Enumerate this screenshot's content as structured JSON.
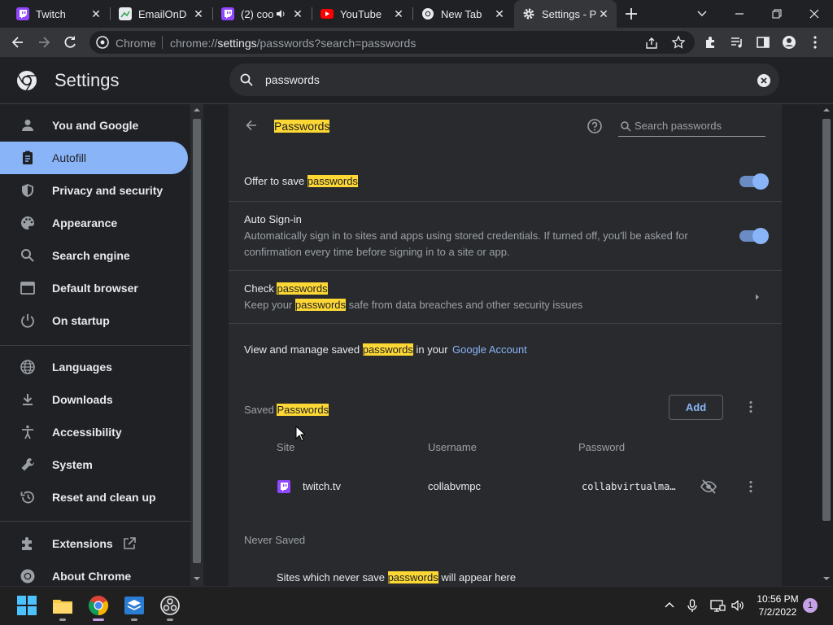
{
  "tabs": [
    {
      "title": "Twitch",
      "icon": "twitch-icon"
    },
    {
      "title": "EmailOnDe",
      "icon": "sheets-icon"
    },
    {
      "title": "(2) coo",
      "icon": "twitch-icon"
    },
    {
      "title": "YouTube",
      "icon": "youtube-icon"
    },
    {
      "title": "New Tab",
      "icon": "chrome-icon"
    },
    {
      "title": "Settings - P",
      "icon": "gear-icon"
    }
  ],
  "omnibox": {
    "site_label": "Chrome",
    "url_prefix": "chrome://",
    "url_host": "settings",
    "url_rest": "/passwords?search=passwords"
  },
  "settings_header": {
    "title": "Settings",
    "search_value": "passwords"
  },
  "sidebar": {
    "items": [
      {
        "label": "You and Google",
        "icon": "person-icon"
      },
      {
        "label": "Autofill",
        "icon": "clipboard-icon"
      },
      {
        "label": "Privacy and security",
        "icon": "shield-icon"
      },
      {
        "label": "Appearance",
        "icon": "palette-icon"
      },
      {
        "label": "Search engine",
        "icon": "search-icon"
      },
      {
        "label": "Default browser",
        "icon": "browser-icon"
      },
      {
        "label": "On startup",
        "icon": "power-icon"
      },
      {
        "label": "Languages",
        "icon": "globe-icon"
      },
      {
        "label": "Downloads",
        "icon": "download-icon"
      },
      {
        "label": "Accessibility",
        "icon": "accessibility-icon"
      },
      {
        "label": "System",
        "icon": "wrench-icon"
      },
      {
        "label": "Reset and clean up",
        "icon": "history-icon"
      },
      {
        "label": "Extensions",
        "icon": "puzzle-icon"
      },
      {
        "label": "About Chrome",
        "icon": "chrome-icon"
      }
    ]
  },
  "passwords": {
    "page_title": "Passwords",
    "search_placeholder": "Search passwords",
    "offer_save_prefix": "Offer to save ",
    "offer_save_hl": "passwords",
    "offer_save_enabled": true,
    "auto_signin_title": "Auto Sign-in",
    "auto_signin_desc_1": "Automatically sign in to sites and apps using stored credentials. If turned off, you'll be asked for",
    "auto_signin_desc_2": "confirmation every time before signing in to a site or app.",
    "auto_signin_enabled": true,
    "check_prefix": "Check ",
    "check_hl": "passwords",
    "check_desc_prefix": "Keep your ",
    "check_desc_hl": "passwords",
    "check_desc_suffix": " safe from data breaches and other security issues",
    "manage_prefix": "View and manage saved ",
    "manage_hl": "passwords",
    "manage_mid": " in your",
    "manage_link": "Google Account",
    "saved_prefix": "Saved ",
    "saved_hl": "Passwords",
    "add_label": "Add",
    "columns": {
      "site": "Site",
      "username": "Username",
      "password": "Password"
    },
    "entries": [
      {
        "site": "twitch.tv",
        "username": "collabvmpc",
        "password": "collabvirtualma…"
      }
    ],
    "never_saved_title": "Never Saved",
    "never_prefix": "Sites which never save ",
    "never_hl": "passwords",
    "never_suffix": " will appear here"
  },
  "taskbar": {
    "time": "10:56 PM",
    "date": "7/2/2022",
    "notification_count": "1"
  },
  "colors": {
    "accent": "#8ab4f8",
    "highlight": "#fdd835",
    "background": "#202124",
    "card": "#292a2d"
  }
}
